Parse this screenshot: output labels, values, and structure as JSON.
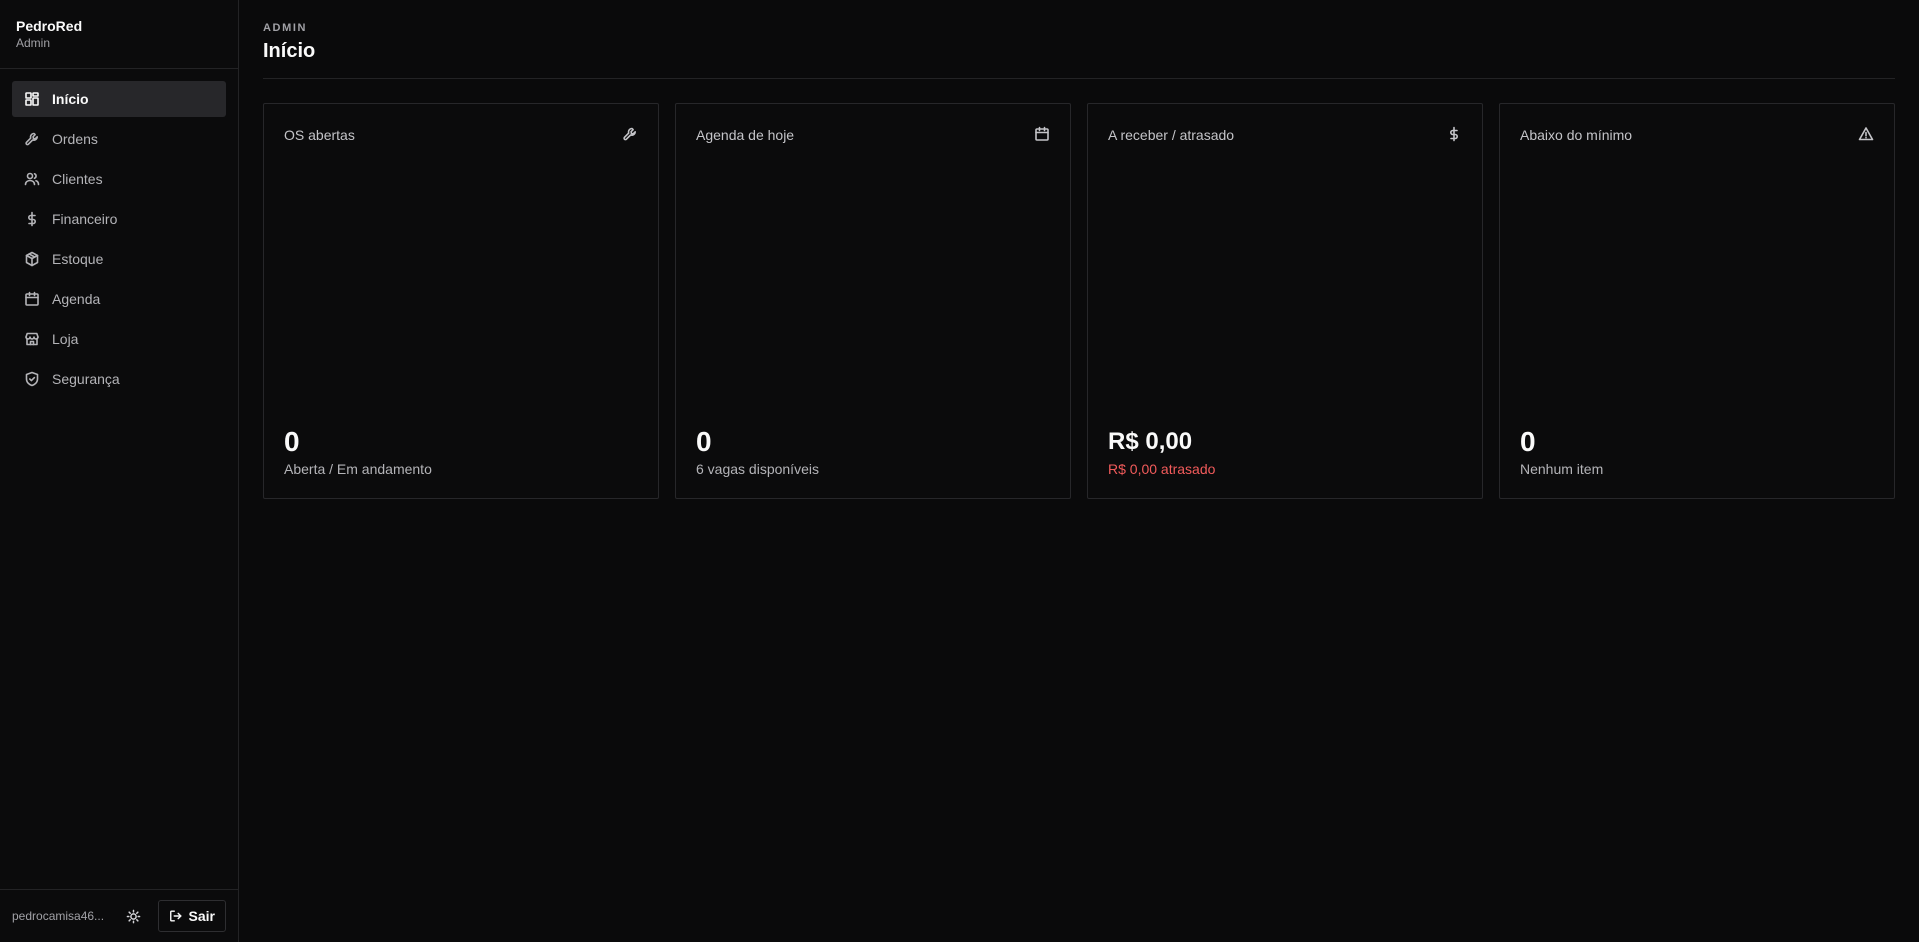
{
  "brand": {
    "name": "PedroRed",
    "role": "Admin"
  },
  "nav": [
    {
      "label": "Início",
      "icon": "dashboard-icon"
    },
    {
      "label": "Ordens",
      "icon": "wrench-icon"
    },
    {
      "label": "Clientes",
      "icon": "users-icon"
    },
    {
      "label": "Financeiro",
      "icon": "dollar-icon"
    },
    {
      "label": "Estoque",
      "icon": "package-icon"
    },
    {
      "label": "Agenda",
      "icon": "calendar-icon"
    },
    {
      "label": "Loja",
      "icon": "store-icon"
    },
    {
      "label": "Segurança",
      "icon": "shield-icon"
    }
  ],
  "footer": {
    "email": "pedrocamisa46...",
    "logout_label": "Sair"
  },
  "header": {
    "eyebrow": "ADMIN",
    "title": "Início"
  },
  "cards": [
    {
      "title": "OS abertas",
      "icon": "wrench-icon",
      "value": "0",
      "sub": "Aberta / Em andamento"
    },
    {
      "title": "Agenda de hoje",
      "icon": "calendar-icon",
      "value": "0",
      "sub": "6 vagas disponíveis"
    },
    {
      "title": "A receber / atrasado",
      "icon": "dollar-icon",
      "value": "R$ 0,00",
      "sub": "R$ 0,00 atrasado",
      "sub_color": "#f25b5b"
    },
    {
      "title": "Abaixo do mínimo",
      "icon": "alert-triangle-icon",
      "value": "0",
      "sub": "Nenhum item"
    }
  ]
}
